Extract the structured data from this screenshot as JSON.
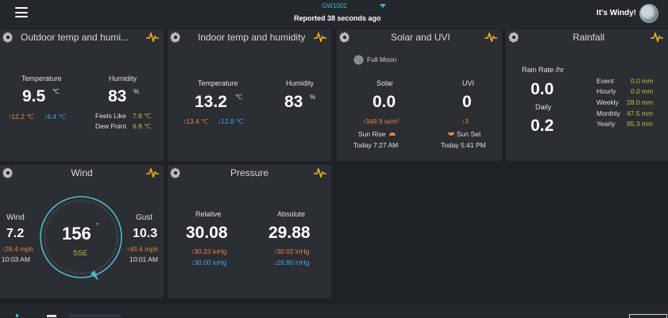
{
  "header": {
    "device": "GW1002",
    "reported": "Reported 38 seconds ago",
    "greeting": "It's Windy!"
  },
  "outdoor": {
    "title": "Outdoor temp and humi...",
    "temp_label": "Temperature",
    "temp_value": "9.5",
    "temp_unit": "℃",
    "temp_hi": "↑12.2 ℃",
    "temp_lo": "↓9.4 ℃",
    "hum_label": "Humidity",
    "hum_value": "83",
    "hum_unit": "%",
    "feels_label": "Feels Like",
    "feels_value": "7.8 ℃",
    "dew_label": "Dew Point",
    "dew_value": "6.8 ℃"
  },
  "indoor": {
    "title": "Indoor temp and humidity",
    "temp_label": "Temperature",
    "temp_value": "13.2",
    "temp_unit": "℃",
    "temp_hi": "↑13.4 ℃",
    "temp_lo": "↓12.8 ℃",
    "hum_label": "Humidity",
    "hum_value": "83",
    "hum_unit": "%"
  },
  "solar": {
    "title": "Solar and UVI",
    "moon": "Full Moon",
    "solar_label": "Solar",
    "solar_value": "0.0",
    "solar_hi": "↑349.9 w/m²",
    "uvi_label": "UVI",
    "uvi_value": "0",
    "uvi_hi": "↑3",
    "sunrise_label": "Sun Rise",
    "sunrise_time": "Today 7:27 AM",
    "sunset_label": "Sun Set",
    "sunset_time": "Today 5:41 PM"
  },
  "rainfall": {
    "title": "Rainfall",
    "rate_label": "Rain Rate /hr",
    "rate_value": "0.0",
    "daily_label": "Daily",
    "daily_value": "0.2",
    "rows": [
      {
        "label": "Event",
        "value": "0.0 mm"
      },
      {
        "label": "Hourly",
        "value": "0.0 mm"
      },
      {
        "label": "Weekly",
        "value": "28.0 mm"
      },
      {
        "label": "Monthly",
        "value": "47.5 mm"
      },
      {
        "label": "Yearly",
        "value": "95.3 mm"
      }
    ]
  },
  "wind": {
    "title": "Wind",
    "wind_label": "Wind",
    "wind_value": "7.2",
    "wind_hi": "↑26.4 mph",
    "wind_time": "10:03 AM",
    "direction_value": "156",
    "direction_unit": "°",
    "direction_text": "SSE",
    "gust_label": "Gust",
    "gust_value": "10.3",
    "gust_hi": "↑45.6 mph",
    "gust_time": "10:01 AM"
  },
  "pressure": {
    "title": "Pressure",
    "rel_label": "Relative",
    "rel_value": "30.08",
    "rel_hi": "↑30.23 inHg",
    "rel_lo": "↓30.00 inHg",
    "abs_label": "Absolute",
    "abs_value": "29.88",
    "abs_hi": "↑30.02 inHg",
    "abs_lo": "↓29.80 inHg"
  },
  "colors": {
    "background": "#1e2126",
    "card": "#2b2e33",
    "accent": "#39b9c6",
    "high": "#f08047",
    "low": "#3fa8d8",
    "green": "#b6c43c",
    "pulse": "#f2b01e"
  }
}
